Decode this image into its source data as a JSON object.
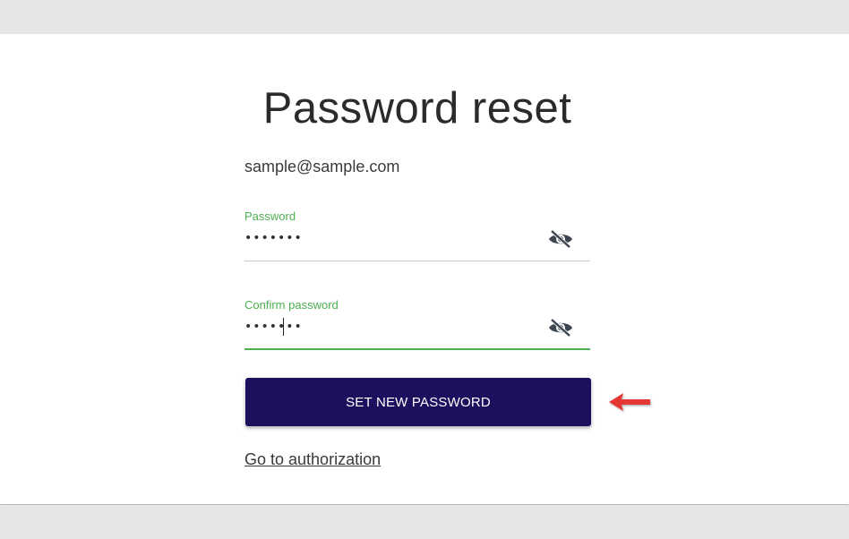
{
  "page": {
    "title": "Password reset",
    "email": "sample@sample.com"
  },
  "password_field": {
    "label": "Password",
    "value": "•••••••",
    "toggle_icon": "eye-off-icon"
  },
  "confirm_field": {
    "label": "Confirm password",
    "value": "•••••••",
    "toggle_icon": "eye-off-icon"
  },
  "actions": {
    "submit_label": "SET NEW PASSWORD",
    "auth_link": "Go to authorization"
  },
  "annotation": {
    "arrow_icon": "arrow-left-icon",
    "arrow_color": "#e53935"
  },
  "colors": {
    "accent_green": "#4caf50",
    "button_bg": "#1e0e5e"
  }
}
